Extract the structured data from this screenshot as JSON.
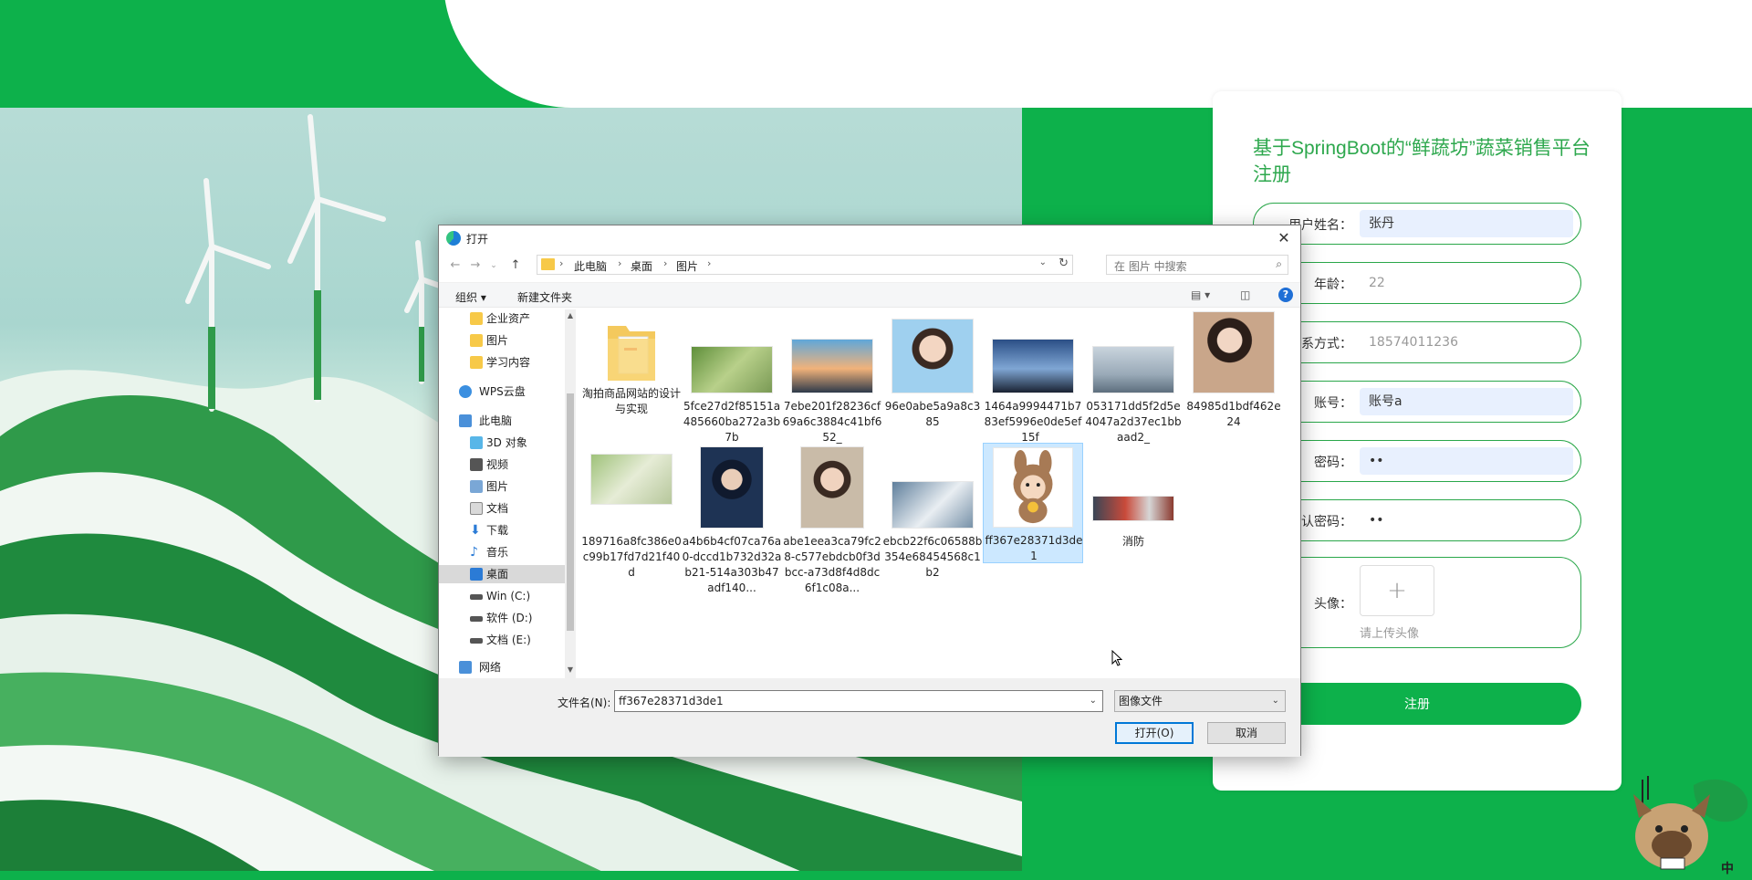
{
  "registration": {
    "title": "基于SpringBoot的“鲜蔬坊”蔬菜销售平台注册",
    "fields": [
      {
        "label": "用户姓名：",
        "value": "张丹",
        "filled": true
      },
      {
        "label": "年龄：",
        "value": "22",
        "filled": false
      },
      {
        "label": "联系方式：",
        "value": "18574011236",
        "filled": false
      },
      {
        "label": "账号：",
        "value": "账号a",
        "filled": true
      },
      {
        "label": "密码：",
        "value": "••",
        "filled": true
      },
      {
        "label": "确认密码：",
        "value": "••",
        "filled": false
      }
    ],
    "avatar_label": "头像：",
    "avatar_plus": "+",
    "avatar_hint": "请上传头像",
    "submit_label": "注册"
  },
  "dialog": {
    "title": "打开",
    "close": "✕",
    "breadcrumb": [
      "此电脑",
      "桌面",
      "图片"
    ],
    "search_placeholder": "在 图片 中搜索",
    "organize_label": "组织 ▾",
    "new_folder_label": "新建文件夹",
    "help": "?",
    "nav_items": [
      {
        "label": "企业资产",
        "type": "folder"
      },
      {
        "label": "图片",
        "type": "folder"
      },
      {
        "label": "学习内容",
        "type": "folder"
      },
      {
        "label": "WPS云盘",
        "type": "cloud"
      },
      {
        "label": "此电脑",
        "type": "pc"
      },
      {
        "label": "3D 对象",
        "type": "3d"
      },
      {
        "label": "视频",
        "type": "video"
      },
      {
        "label": "图片",
        "type": "pics"
      },
      {
        "label": "文档",
        "type": "docs"
      },
      {
        "label": "下载",
        "type": "download"
      },
      {
        "label": "音乐",
        "type": "music"
      },
      {
        "label": "桌面",
        "type": "desktop",
        "selected": true
      },
      {
        "label": "Win (C:)",
        "type": "drive"
      },
      {
        "label": "软件 (D:)",
        "type": "drive"
      },
      {
        "label": "文档 (E:)",
        "type": "drive"
      },
      {
        "label": "网络",
        "type": "network"
      }
    ],
    "files": [
      {
        "name": "淘拍商品网站的设计与实现",
        "kind": "folder"
      },
      {
        "name": "5fce27d2f85151a485660ba272a3b7b",
        "kind": "cat"
      },
      {
        "name": "7ebe201f28236cf69a6c3884c41bf652_",
        "kind": "sunset"
      },
      {
        "name": "96e0abe5a9a8c385",
        "kind": "portrait"
      },
      {
        "name": "1464a9994471b783ef5996e0de5ef15f_",
        "kind": "dusk"
      },
      {
        "name": "053171dd5f2d5e4047a2d37ec1bbaad2_",
        "kind": "sea"
      },
      {
        "name": "84985d1bdf462e24",
        "kind": "woman"
      },
      {
        "name": "189716a8fc386e0c99b17fd7d21f40d",
        "kind": "baby"
      },
      {
        "name": "a4b6b4cf07ca76a0-dccd1b732d32ab21-514a303b47adf140...",
        "kind": "boy"
      },
      {
        "name": "abe1eea3ca79fc28-c577ebdcb0f3dbcc-a73d8f4d8dc6f1c08a...",
        "kind": "glasses"
      },
      {
        "name": "ebcb22f6c06588b354e68454568c1b2",
        "kind": "whitecat"
      },
      {
        "name": "ff367e28371d3de1",
        "kind": "bunny",
        "selected": true
      },
      {
        "name": "消防",
        "kind": "fire"
      }
    ],
    "filename_label": "文件名(N):",
    "filename_value": "ff367e28371d3de1",
    "filetype_value": "图像文件",
    "open_label": "打开(O)",
    "cancel_label": "取消"
  },
  "mascot_text": "中"
}
